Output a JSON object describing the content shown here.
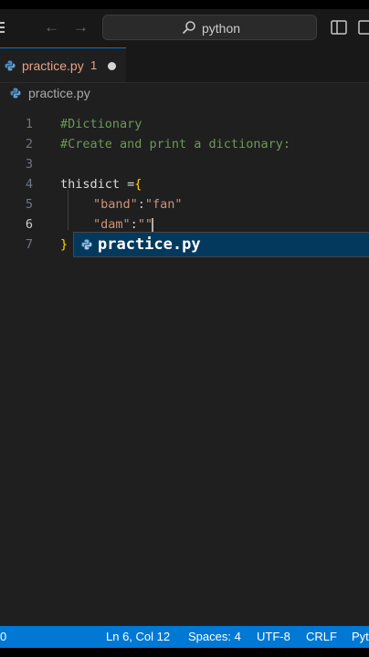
{
  "titlebar": {
    "search_text": "python"
  },
  "tab": {
    "label": "practice.py",
    "problem_count": "1"
  },
  "breadcrumb": {
    "file": "practice.py"
  },
  "editor": {
    "active_line": "6",
    "lines": [
      {
        "num": "1",
        "tokens": [
          {
            "t": "#Dictionary",
            "k": "comment"
          }
        ]
      },
      {
        "num": "2",
        "tokens": [
          {
            "t": "#Create and print a dictionary:",
            "k": "comment"
          }
        ]
      },
      {
        "num": "3",
        "tokens": []
      },
      {
        "num": "4",
        "tokens": [
          {
            "t": "thisdict =",
            "k": "var"
          },
          {
            "t": "{",
            "k": "brace"
          }
        ]
      },
      {
        "num": "5",
        "tokens": [
          {
            "t": "\"band\"",
            "k": "str"
          },
          {
            "t": ":",
            "k": "punct"
          },
          {
            "t": "\"fan\"",
            "k": "str"
          }
        ]
      },
      {
        "num": "6",
        "tokens": [
          {
            "t": "\"dam\"",
            "k": "str"
          },
          {
            "t": ":",
            "k": "punct"
          },
          {
            "t": "\"\"",
            "k": "str"
          }
        ]
      },
      {
        "num": "7",
        "tokens": [
          {
            "t": "}",
            "k": "brace"
          }
        ]
      }
    ]
  },
  "suggestion": {
    "label": "practice.py"
  },
  "statusbar": {
    "problems": "0",
    "position": "Ln 6, Col 12",
    "spaces": "Spaces: 4",
    "encoding": "UTF-8",
    "eol": "CRLF",
    "language": "Python"
  },
  "colors": {
    "accent": "#0078d4",
    "editor_bg": "#1f1f1f",
    "comment": "#6a9955",
    "string": "#ce9178",
    "brace": "#ffd700",
    "modified_tab": "#e8a287"
  }
}
